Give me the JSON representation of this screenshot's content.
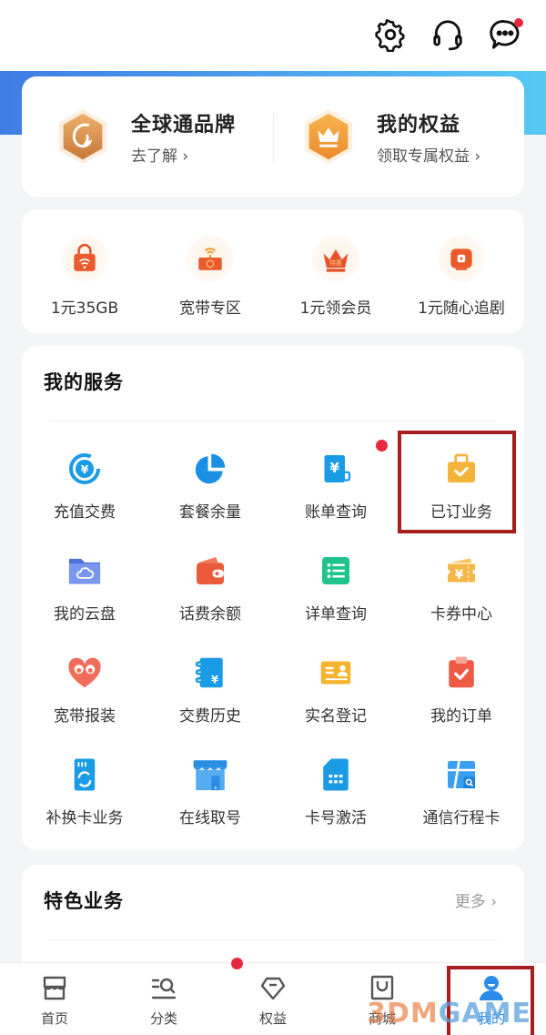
{
  "header": {
    "icons": [
      "gear-icon",
      "headset-icon",
      "chat-icon"
    ],
    "chat_has_badge": true
  },
  "promo": {
    "items": [
      {
        "title": "全球通品牌",
        "subtitle": "去了解 ›",
        "icon": "brand-hexagon-icon"
      },
      {
        "title": "我的权益",
        "subtitle": "领取专属权益 ›",
        "icon": "crown-hexagon-icon"
      }
    ]
  },
  "quick": {
    "items": [
      {
        "label": "1元35GB",
        "icon": "wifi-bag-icon"
      },
      {
        "label": "宽带专区",
        "icon": "router-icon"
      },
      {
        "label": "1元领会员",
        "icon": "crown-vip-icon"
      },
      {
        "label": "1元随心追剧",
        "icon": "video-play-icon"
      }
    ]
  },
  "services": {
    "title": "我的服务",
    "items": [
      {
        "label": "充值交费",
        "icon": "recharge-icon"
      },
      {
        "label": "套餐余量",
        "icon": "pie-chart-icon"
      },
      {
        "label": "账单查询",
        "icon": "bill-icon",
        "badge": true
      },
      {
        "label": "已订业务",
        "icon": "briefcase-check-icon",
        "highlighted": true
      },
      {
        "label": "我的云盘",
        "icon": "cloud-folder-icon"
      },
      {
        "label": "话费余额",
        "icon": "wallet-icon"
      },
      {
        "label": "详单查询",
        "icon": "list-icon"
      },
      {
        "label": "卡券中心",
        "icon": "coupon-icon"
      },
      {
        "label": "宽带报装",
        "icon": "heart-people-icon"
      },
      {
        "label": "交费历史",
        "icon": "notebook-yuan-icon"
      },
      {
        "label": "实名登记",
        "icon": "id-card-icon"
      },
      {
        "label": "我的订单",
        "icon": "clipboard-check-icon"
      },
      {
        "label": "补换卡业务",
        "icon": "sim-swap-icon"
      },
      {
        "label": "在线取号",
        "icon": "store-icon"
      },
      {
        "label": "卡号激活",
        "icon": "sim-card-icon"
      },
      {
        "label": "通信行程卡",
        "icon": "trip-card-icon"
      }
    ]
  },
  "features": {
    "title": "特色业务",
    "more_label": "更多 ›"
  },
  "tabbar": {
    "items": [
      {
        "label": "首页",
        "icon": "home-icon"
      },
      {
        "label": "分类",
        "icon": "category-search-icon"
      },
      {
        "label": "权益",
        "icon": "diamond-icon"
      },
      {
        "label": "商城",
        "icon": "shopping-bag-icon"
      },
      {
        "label": "我的",
        "icon": "user-icon",
        "active": true
      }
    ]
  },
  "watermark": {
    "part1": "3DM",
    "part2": "GAME"
  },
  "colors": {
    "accent_blue": "#2b8be8",
    "badge_red": "#e8283f",
    "highlight_red": "#a81e1e"
  }
}
